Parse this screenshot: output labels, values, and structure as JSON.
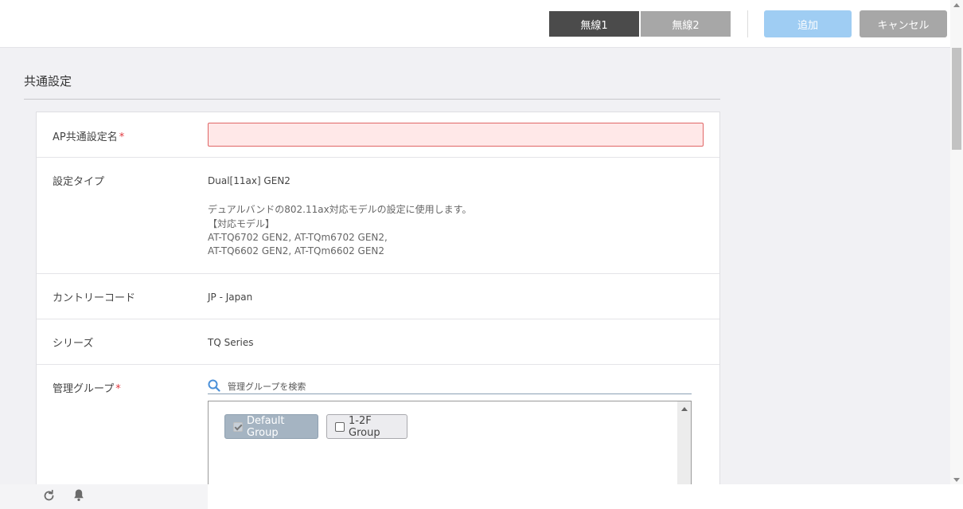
{
  "header": {
    "tabs": [
      {
        "label": "無線1",
        "active": true
      },
      {
        "label": "無線2",
        "active": false
      }
    ],
    "add_label": "追加",
    "cancel_label": "キャンセル"
  },
  "section": {
    "title": "共通設定"
  },
  "form": {
    "name_label": "AP共通設定名",
    "required_mark": "*",
    "name_value": "",
    "type_label": "設定タイプ",
    "type_value": "Dual[11ax] GEN2",
    "type_desc_1": "デュアルバンドの802.11ax対応モデルの設定に使用します。",
    "type_desc_2": "【対応モデル】",
    "type_desc_3": "AT-TQ6702 GEN2, AT-TQm6702 GEN2,",
    "type_desc_4": "AT-TQ6602 GEN2, AT-TQm6602 GEN2",
    "country_label": "カントリーコード",
    "country_value": "JP - Japan",
    "series_label": "シリーズ",
    "series_value": "TQ Series",
    "group_label": "管理グループ",
    "group_search_placeholder": "管理グループを検索",
    "groups": [
      {
        "label": "Default Group",
        "checked": true
      },
      {
        "label": "1-2F Group",
        "checked": false
      }
    ]
  },
  "colors": {
    "tab_active": "#4b4b4b",
    "tab_inactive": "#a7a7a7",
    "add_button": "#9fcdf3",
    "cancel_button": "#a7a7a7",
    "required": "#e0383e",
    "error_input_bg": "#ffe8e8"
  },
  "footer_icons": [
    "refresh-icon",
    "bell-icon"
  ]
}
